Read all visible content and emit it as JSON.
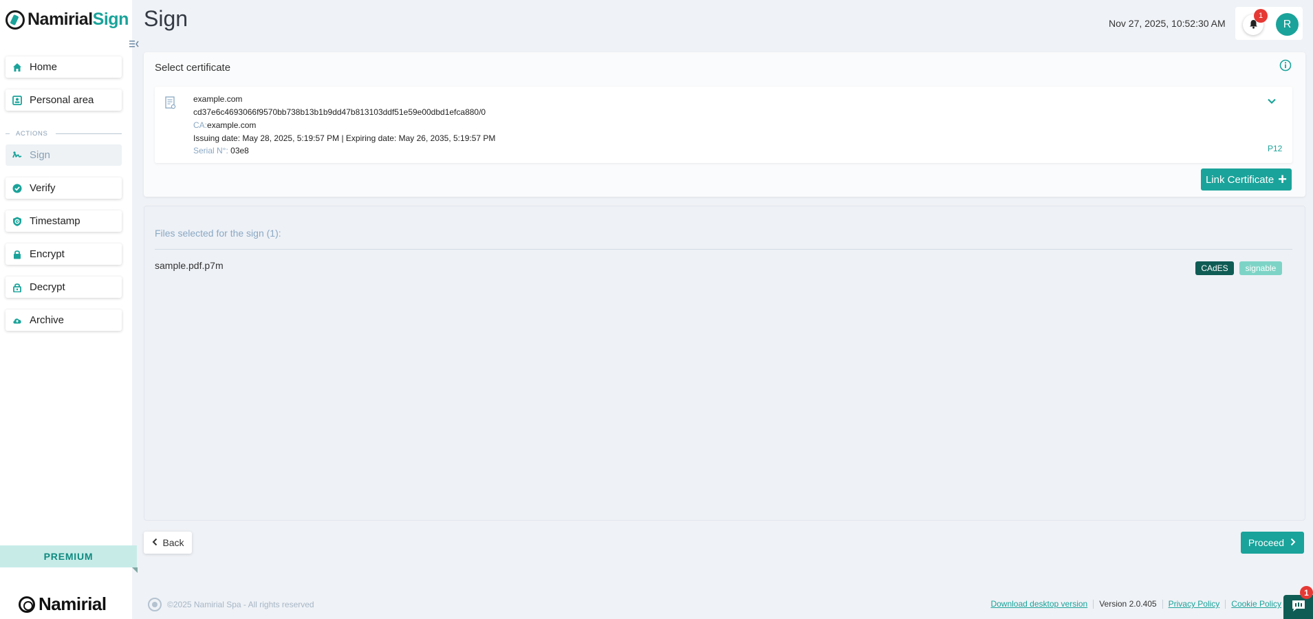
{
  "app": {
    "logo_name": "Namirial",
    "logo_accent": "Sign",
    "brand_footer": "Namirial",
    "accent_color": "#1aa39a",
    "dark_accent_color": "#0f5c55"
  },
  "sidebar": {
    "items": [
      {
        "label": "Home",
        "icon": "home-icon"
      },
      {
        "label": "Personal area",
        "icon": "contact-card-icon"
      }
    ],
    "actions_label": "ACTIONS",
    "action_items": [
      {
        "label": "Sign",
        "icon": "signature-icon",
        "active": true
      },
      {
        "label": "Verify",
        "icon": "verified-badge-icon"
      },
      {
        "label": "Timestamp",
        "icon": "shield-clock-icon"
      },
      {
        "label": "Encrypt",
        "icon": "lock-icon"
      },
      {
        "label": "Decrypt",
        "icon": "unlock-icon"
      },
      {
        "label": "Archive",
        "icon": "cloud-upload-icon"
      }
    ],
    "premium_label": "PREMIUM"
  },
  "header": {
    "title": "Sign",
    "datetime": "Nov 27, 2025, 10:52:30 AM",
    "notification_count": "1",
    "avatar_initial": "R"
  },
  "certificate": {
    "section_title": "Select certificate",
    "name": "example.com",
    "id": "cd37e6c4693066f9570bb738b13b1b9dd47b813103ddf51e59e00dbd1efca880/0",
    "ca_label": "CA:",
    "ca_value": "example.com",
    "dates": "Issuing date: May 28, 2025, 5:19:57 PM | Expiring date: May 26, 2035, 5:19:57 PM",
    "serial_label": "Serial N°:",
    "serial_value": "03e8",
    "type": "P12",
    "link_button": "Link Certificate"
  },
  "files": {
    "heading": "Files selected for the sign (1):",
    "items": [
      {
        "name": "sample.pdf.p7m",
        "format_badge": "CAdES",
        "status_badge": "signable"
      }
    ]
  },
  "navigation": {
    "back_label": "Back",
    "proceed_label": "Proceed"
  },
  "footer": {
    "copyright": "©2025 Namirial Spa - All rights reserved",
    "download_link": "Download desktop version",
    "version": "Version 2.0.405",
    "privacy_link": "Privacy Policy",
    "cookie_link": "Cookie Policy",
    "chat_badge": "1"
  }
}
